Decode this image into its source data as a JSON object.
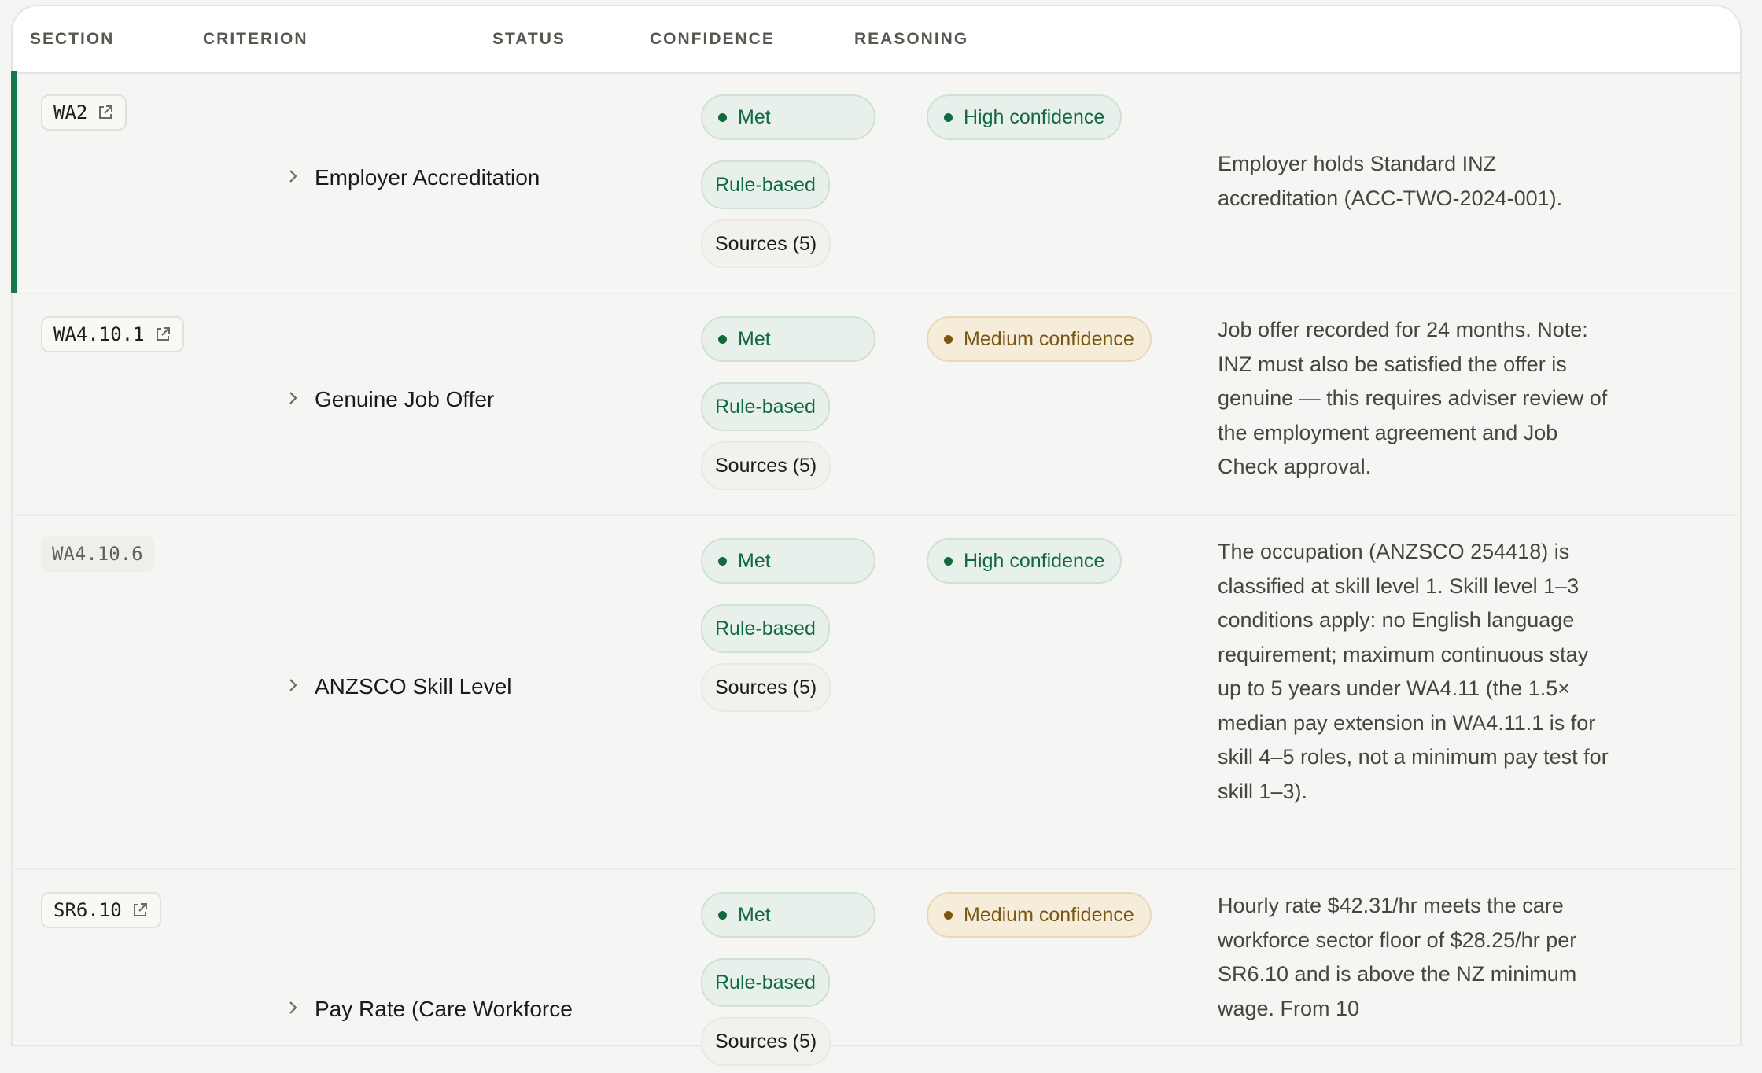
{
  "columns": {
    "section": "SECTION",
    "criterion": "CRITERION",
    "status": "STATUS",
    "confidence": "CONFIDENCE",
    "reasoning": "REASONING"
  },
  "rows": [
    {
      "section": "WA2",
      "criterion": "Employer Accreditation",
      "status": "Met",
      "method": "Rule-based",
      "sources": "Sources (5)",
      "confidence": "High confidence",
      "reasoning": "Employer holds Standard INZ accreditation (ACC-TWO-2024-001)."
    },
    {
      "section": "WA4.10.1",
      "criterion": "Genuine Job Offer",
      "status": "Met",
      "method": "Rule-based",
      "sources": "Sources (5)",
      "confidence": "Medium confidence",
      "reasoning": "Job offer recorded for 24 months. Note: INZ must also be satisfied the offer is genuine — this requires adviser review of the employment agreement and Job Check approval."
    },
    {
      "section": "WA4.10.6",
      "criterion": "ANZSCO Skill Level",
      "status": "Met",
      "method": "Rule-based",
      "sources": "Sources (5)",
      "confidence": "High confidence",
      "reasoning": "The occupation (ANZSCO 254418) is classified at skill level 1. Skill level 1–3 conditions apply: no English language requirement; maximum continuous stay up to 5 years under WA4.11 (the 1.5× median pay extension in WA4.11.1 is for skill 4–5 roles, not a minimum pay test for skill 1–3)."
    },
    {
      "section": "SR6.10",
      "criterion": "Pay Rate (Care Workforce",
      "status": "Met",
      "method": "Rule-based",
      "sources": "Sources (5)",
      "confidence": "Medium confidence",
      "reasoning": "Hourly rate $42.31/hr meets the care workforce sector floor of $28.25/hr per SR6.10 and is above the NZ minimum wage. From 10"
    }
  ],
  "colors": {
    "accent": "#127a48",
    "met_text": "#12693e",
    "medium_text": "#7b5514"
  }
}
